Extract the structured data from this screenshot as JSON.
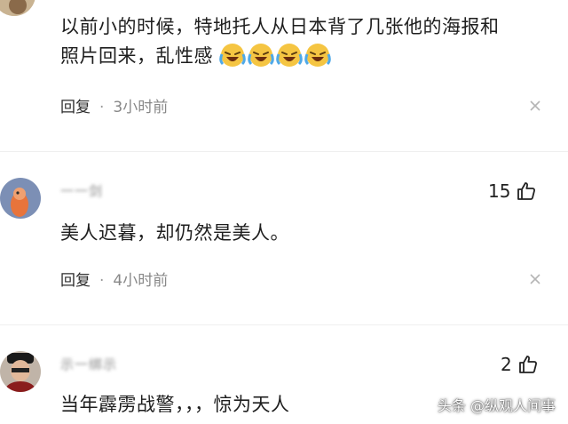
{
  "comments": [
    {
      "text_line1": "以前小的时候，特地托人从日本背了几张他的海报和",
      "text_line2": "照片回来，乱性感",
      "emojis": [
        "cry-laugh-icon",
        "cry-laugh-icon",
        "cry-laugh-icon",
        "cry-laugh-icon"
      ],
      "reply_label": "回复",
      "separator": "·",
      "time": "3小时前"
    },
    {
      "username": "一一剑",
      "text": "美人迟暮，却仍然是美人。",
      "likes": "15",
      "reply_label": "回复",
      "separator": "·",
      "time": "4小时前"
    },
    {
      "username": "示一绑示",
      "text": "当年霹雳战警，，，惊为天人",
      "likes": "2"
    }
  ],
  "watermark": "头条 @纵观人间事",
  "colors": {
    "background": "#ffffff",
    "text": "#1e1e1e",
    "meta": "#888888",
    "emoji_face": "#f5c542",
    "avatar2_bg": "#7c8fb5"
  }
}
